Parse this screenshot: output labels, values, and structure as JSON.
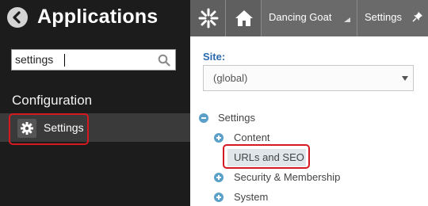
{
  "left_panel": {
    "title": "Applications",
    "search": {
      "value": "settings",
      "placeholder": ""
    },
    "section_heading": "Configuration",
    "results": [
      {
        "label": "Settings",
        "icon": "gear-icon",
        "selected": true
      }
    ]
  },
  "topbar": {
    "logo_icon": "kentico-logo-icon",
    "home_icon": "home-icon",
    "site_name": "Dancing Goat",
    "current_app": "Settings",
    "pin_icon": "pin-icon"
  },
  "content": {
    "site_label": "Site:",
    "site_select_value": "(global)",
    "tree": {
      "root": "Settings",
      "children": [
        {
          "label": "Content",
          "expandable": true
        },
        {
          "label": "URLs and SEO",
          "expandable": false,
          "selected": true
        },
        {
          "label": "Security & Membership",
          "expandable": true
        },
        {
          "label": "System",
          "expandable": true
        }
      ]
    }
  },
  "colors": {
    "highlight_border": "#d61920",
    "left_bg": "#1c1c1c",
    "topbar_bg": "#6a6a6a",
    "site_label": "#2a6ab0",
    "tree_bullet": "#5aa0c8"
  }
}
